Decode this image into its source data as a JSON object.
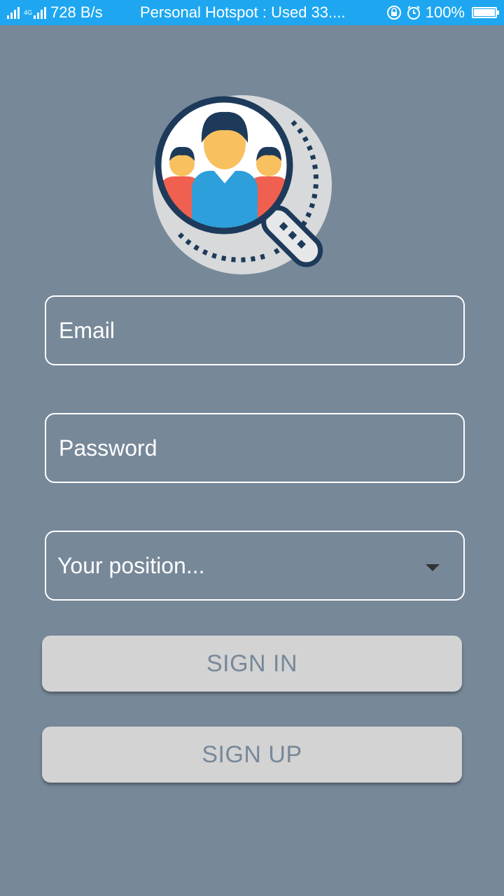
{
  "status_bar": {
    "network_type": "4G",
    "speed": "728 B/s",
    "notification": "Personal Hotspot : Used  33....",
    "battery": "100%",
    "battery_level": 1.0
  },
  "login": {
    "email_placeholder": "Email",
    "password_placeholder": "Password",
    "position_placeholder": "Your position...",
    "sign_in_label": "SIGN IN",
    "sign_up_label": "SIGN UP"
  },
  "colors": {
    "background": "#778899",
    "status_bar": "#1ea7f0",
    "button_bg": "#d3d3d3",
    "button_text": "#778899"
  }
}
